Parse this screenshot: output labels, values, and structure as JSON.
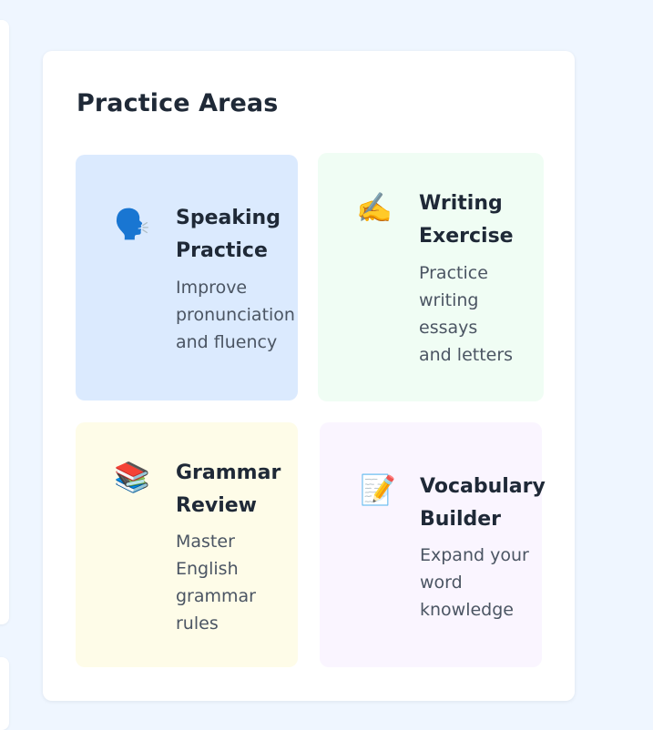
{
  "practice": {
    "heading": "Practice Areas",
    "colors": {
      "speaking": "#dbeafe",
      "writing": "#f0fdf4",
      "grammar": "#fefce8",
      "vocabulary": "#faf5ff"
    },
    "cards": [
      {
        "icon": "speaking-head-icon",
        "icon_glyph": "🗣️",
        "title": "Speaking\nPractice",
        "description": "Improve\npronunciation\nand fluency"
      },
      {
        "icon": "writing-hand-icon",
        "icon_glyph": "✍️",
        "title": "Writing\nExercise",
        "description": "Practice\nwriting\nessays\nand letters"
      },
      {
        "icon": "books-icon",
        "icon_glyph": "📚",
        "title": "Grammar\nReview",
        "description": "Master\nEnglish\ngrammar\nrules"
      },
      {
        "icon": "memo-icon",
        "icon_glyph": "📝",
        "title": "Vocabulary\nBuilder",
        "description": "Expand your\nword\nknowledge"
      }
    ]
  }
}
